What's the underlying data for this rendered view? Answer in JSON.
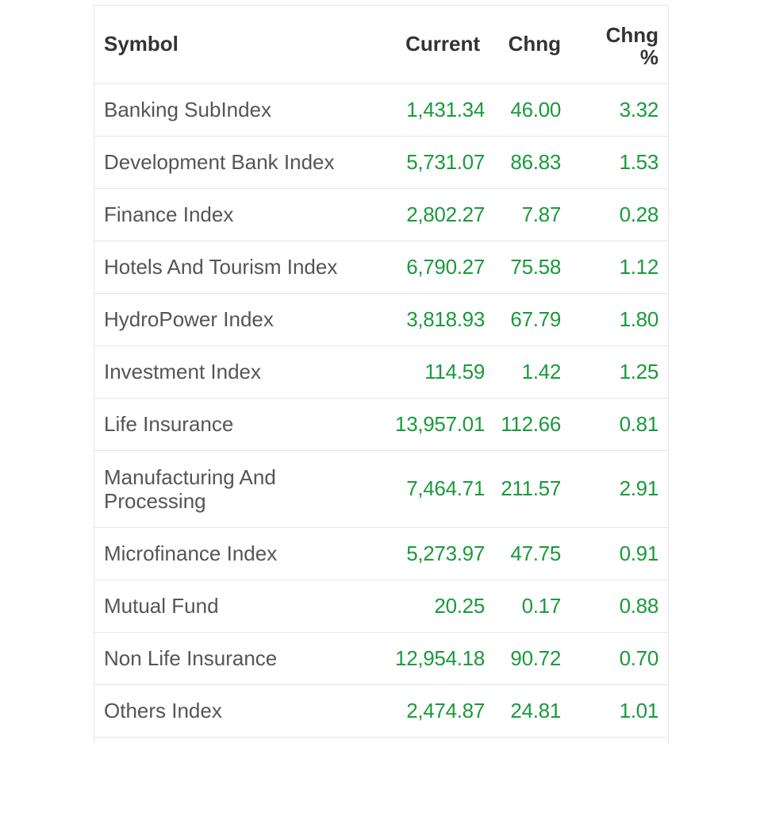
{
  "colors": {
    "positive": "#1a9a3c",
    "symbol_text": "#555555",
    "header_text": "#333333",
    "border": "#e6e6e6"
  },
  "table": {
    "headers": {
      "symbol": "Symbol",
      "current": "Current",
      "chng": "Chng",
      "chng_pct_line1": "Chng",
      "chng_pct_line2": "%"
    },
    "rows": [
      {
        "symbol": "Banking SubIndex",
        "current": "1,431.34",
        "chng": "46.00",
        "chng_pct": "3.32"
      },
      {
        "symbol": "Development Bank Index",
        "current": "5,731.07",
        "chng": "86.83",
        "chng_pct": "1.53"
      },
      {
        "symbol": "Finance Index",
        "current": "2,802.27",
        "chng": "7.87",
        "chng_pct": "0.28"
      },
      {
        "symbol": "Hotels And Tourism Index",
        "current": "6,790.27",
        "chng": "75.58",
        "chng_pct": "1.12"
      },
      {
        "symbol": "HydroPower Index",
        "current": "3,818.93",
        "chng": "67.79",
        "chng_pct": "1.80"
      },
      {
        "symbol": "Investment Index",
        "current": "114.59",
        "chng": "1.42",
        "chng_pct": "1.25"
      },
      {
        "symbol": "Life Insurance",
        "current": "13,957.01",
        "chng": "112.66",
        "chng_pct": "0.81"
      },
      {
        "symbol": "Manufacturing And Processing",
        "current": "7,464.71",
        "chng": "211.57",
        "chng_pct": "2.91"
      },
      {
        "symbol": "Microfinance Index",
        "current": "5,273.97",
        "chng": "47.75",
        "chng_pct": "0.91"
      },
      {
        "symbol": "Mutual Fund",
        "current": "20.25",
        "chng": "0.17",
        "chng_pct": "0.88"
      },
      {
        "symbol": "Non Life Insurance",
        "current": "12,954.18",
        "chng": "90.72",
        "chng_pct": "0.70"
      },
      {
        "symbol": "Others Index",
        "current": "2,474.87",
        "chng": "24.81",
        "chng_pct": "1.01"
      }
    ]
  }
}
